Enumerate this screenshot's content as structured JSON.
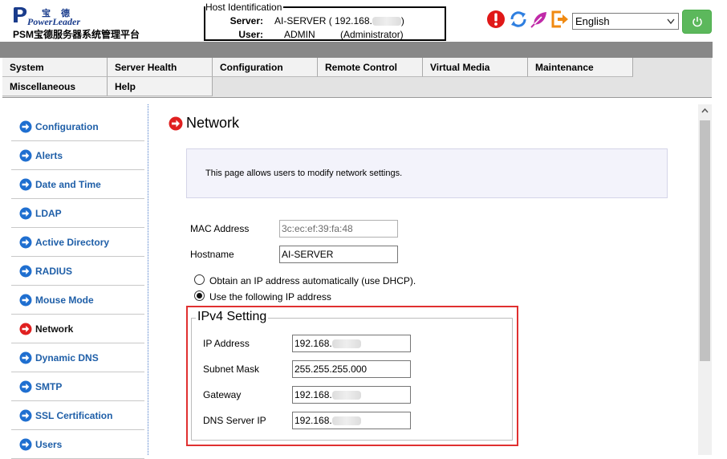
{
  "header": {
    "logo_cn": "宝 德",
    "logo_en": "PowerLeader",
    "product_name": "PSM宝德服务器系统管理平台",
    "host_identification": {
      "legend": "Host Identification",
      "server_label": "Server:",
      "server_value": "AI-SERVER  ( 192.168.",
      "server_suffix": ")",
      "user_label": "User:",
      "user_value": "ADMIN",
      "user_role": "(Administrator)"
    },
    "toolbar_icons": [
      "alert-icon",
      "refresh-icon",
      "feather-icon",
      "logout-icon"
    ],
    "language": {
      "selected": "English"
    },
    "power_icon": "power-icon"
  },
  "nav": {
    "row1": [
      "System",
      "Server Health",
      "Configuration",
      "Remote Control",
      "Virtual Media",
      "Maintenance"
    ],
    "row2": [
      "Miscellaneous",
      "Help"
    ]
  },
  "sidebar": {
    "items": [
      {
        "label": "Configuration",
        "active": false
      },
      {
        "label": "Alerts",
        "active": false
      },
      {
        "label": "Date and Time",
        "active": false
      },
      {
        "label": "LDAP",
        "active": false
      },
      {
        "label": "Active Directory",
        "active": false
      },
      {
        "label": "RADIUS",
        "active": false
      },
      {
        "label": "Mouse Mode",
        "active": false
      },
      {
        "label": "Network",
        "active": true
      },
      {
        "label": "Dynamic DNS",
        "active": false
      },
      {
        "label": "SMTP",
        "active": false
      },
      {
        "label": "SSL Certification",
        "active": false
      },
      {
        "label": "Users",
        "active": false
      }
    ]
  },
  "main": {
    "title": "Network",
    "info": "This page allows users to modify network settings.",
    "mac_label": "MAC Address",
    "mac_value": "3c:ec:ef:39:fa:48",
    "hostname_label": "Hostname",
    "hostname_value": "AI-SERVER",
    "dhcp_option": "Obtain an IP address automatically (use DHCP).",
    "static_option": "Use the following IP address",
    "static_selected": true,
    "ipv4": {
      "legend": "IPv4 Setting",
      "ip_label": "IP Address",
      "ip_value": "192.168.",
      "mask_label": "Subnet Mask",
      "mask_value": "255.255.255.000",
      "gateway_label": "Gateway",
      "gateway_value": "192.168.",
      "dns_label": "DNS Server IP",
      "dns_value": "192.168."
    }
  },
  "colors": {
    "sidebar_link": "#1f5fa8",
    "active_arrow": "#e02020",
    "arrow_blue": "#1f6fd0",
    "highlight_red": "#e03030",
    "power_green": "#5cb85c"
  }
}
